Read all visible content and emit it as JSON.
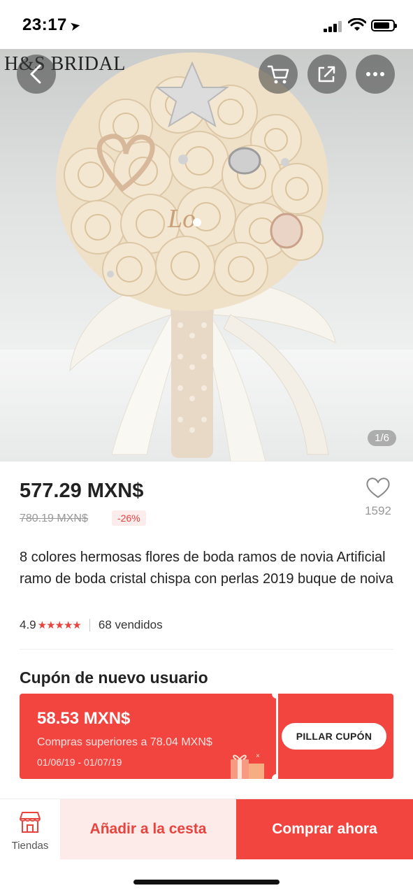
{
  "status_bar": {
    "time": "23:17",
    "location_icon": "location-arrow-icon"
  },
  "hero": {
    "brand_watermark": "H&S BRIDAL",
    "page_counter": "1/6",
    "buttons": {
      "back": "back-arrow-icon",
      "cart": "cart-icon",
      "share": "share-icon",
      "more": "more-icon"
    }
  },
  "product": {
    "price": "577.29 MXN$",
    "original_price": "780.19 MXN$",
    "discount": "-26%",
    "wishlist_count": "1592",
    "title": "8 colores hermosas flores de boda ramos de novia Artificial ramo de boda cristal chispa con perlas 2019 buque de noiva",
    "rating": "4.9",
    "stars": "★★★★★",
    "sold": "68 vendidos"
  },
  "coupon": {
    "heading": "Cupón de nuevo usuario",
    "amount": "58.53 MXN$",
    "condition": "Compras superiores a 78.04 MXN$",
    "dates": "01/06/19 - 01/07/19",
    "claim_label": "PILLAR CUPÓN"
  },
  "bottom_bar": {
    "stores_label": "Tiendas",
    "add_to_cart": "Añadir a la cesta",
    "buy_now": "Comprar ahora"
  },
  "colors": {
    "accent": "#f2453f",
    "accent_light": "#fdebea",
    "star": "#e8433d"
  }
}
